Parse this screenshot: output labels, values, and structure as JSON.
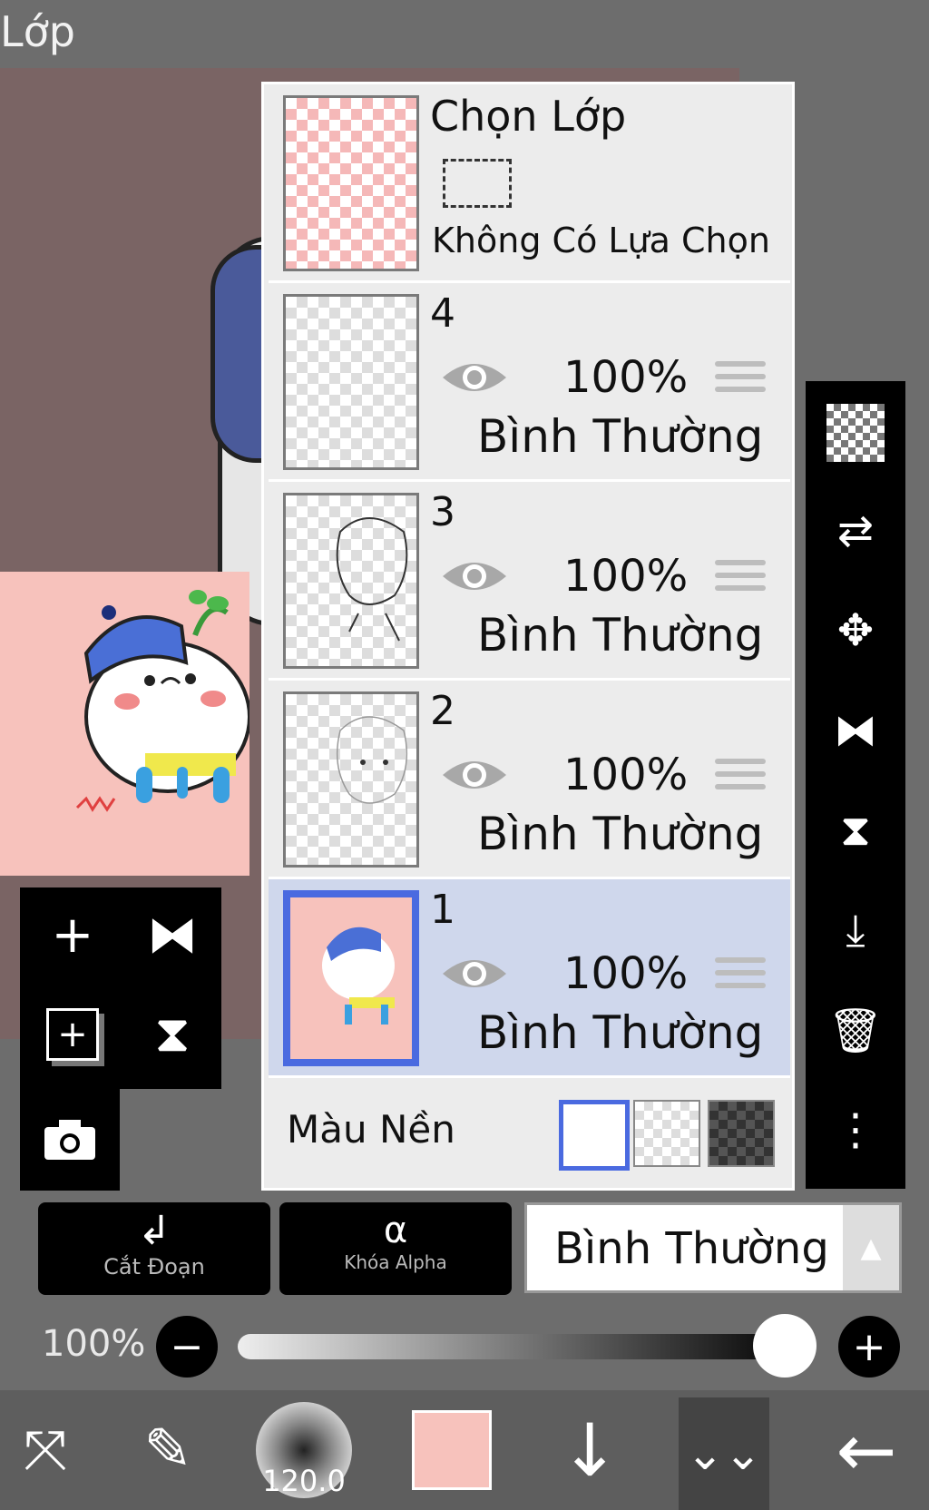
{
  "header": {
    "title": "Lớp"
  },
  "selection_layer": {
    "title": "Chọn Lớp",
    "status": "Không Có Lựa Chọn"
  },
  "layers": [
    {
      "number": "4",
      "opacity": "100%",
      "mode": "Bình Thường"
    },
    {
      "number": "3",
      "opacity": "100%",
      "mode": "Bình Thường"
    },
    {
      "number": "2",
      "opacity": "100%",
      "mode": "Bình Thường"
    },
    {
      "number": "1",
      "opacity": "100%",
      "mode": "Bình Thường",
      "selected": true
    }
  ],
  "background": {
    "label": "Màu Nền"
  },
  "buttons": {
    "clip": "Cắt Đoạn",
    "alpha_lock": "Khóa Alpha"
  },
  "blend_mode": {
    "value": "Bình Thường"
  },
  "opacity_slider": {
    "value_label": "100%",
    "level": 1.0
  },
  "bottom_bar": {
    "brush_size": "120.0",
    "color": "#f7c2bc"
  },
  "colors": {
    "accent": "#4a6ae0",
    "selected_row": "#cfd7ec"
  }
}
